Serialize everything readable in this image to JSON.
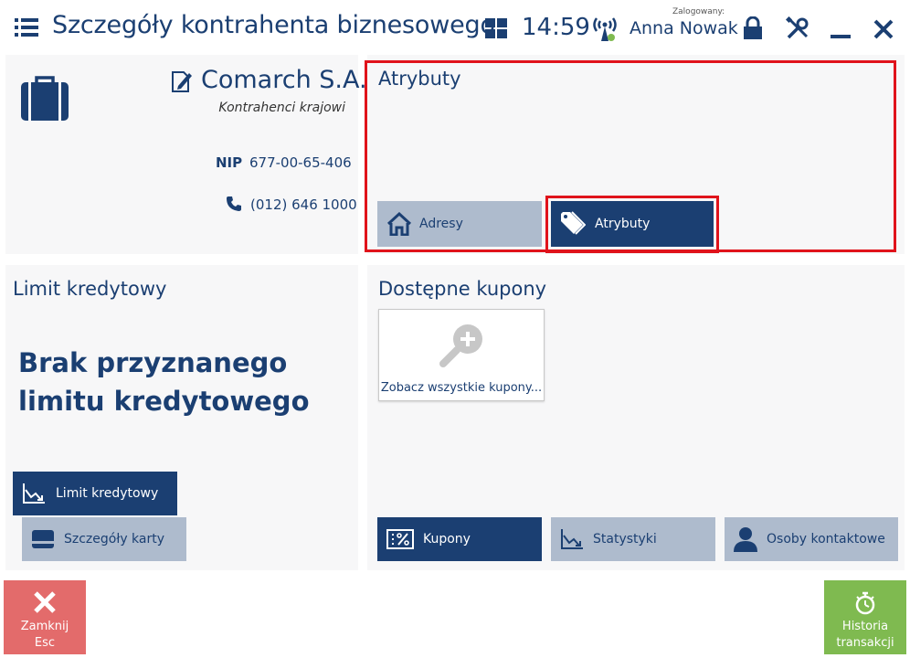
{
  "header": {
    "title": "Szczegóły kontrahenta biznesowego",
    "time": "14:59",
    "logged_label": "Zalogowany:",
    "user_name": "Anna Nowak"
  },
  "contractor": {
    "name": "Comarch S.A.",
    "group": "Kontrahenci krajowi",
    "nip_label": "NIP",
    "nip_value": "677-00-65-406",
    "phone": "(012) 646 1000"
  },
  "attributes": {
    "title": "Atrybuty",
    "buttons": {
      "addresses": "Adresy",
      "attributes": "Atrybuty"
    }
  },
  "credit": {
    "title": "Limit kredytowy",
    "message": "Brak przyznanego limitu kredytowego",
    "buttons": {
      "credit_limit": "Limit kredytowy",
      "card_details": "Szczegóły karty"
    }
  },
  "coupons": {
    "title": "Dostępne kupony",
    "tile_label": "Zobacz wszystkie kupony...",
    "buttons": {
      "coupons": "Kupony",
      "stats": "Statystyki",
      "contacts": "Osoby kontaktowe"
    }
  },
  "bottom": {
    "close_line1": "Zamknij",
    "close_line2": "Esc",
    "history_line1": "Historia",
    "history_line2": "transakcji"
  },
  "colors": {
    "primary": "#1b3f72",
    "secondary_button": "#aebbcd",
    "close": "#e36b6b",
    "history": "#7fba50",
    "highlight": "#e0131b"
  }
}
